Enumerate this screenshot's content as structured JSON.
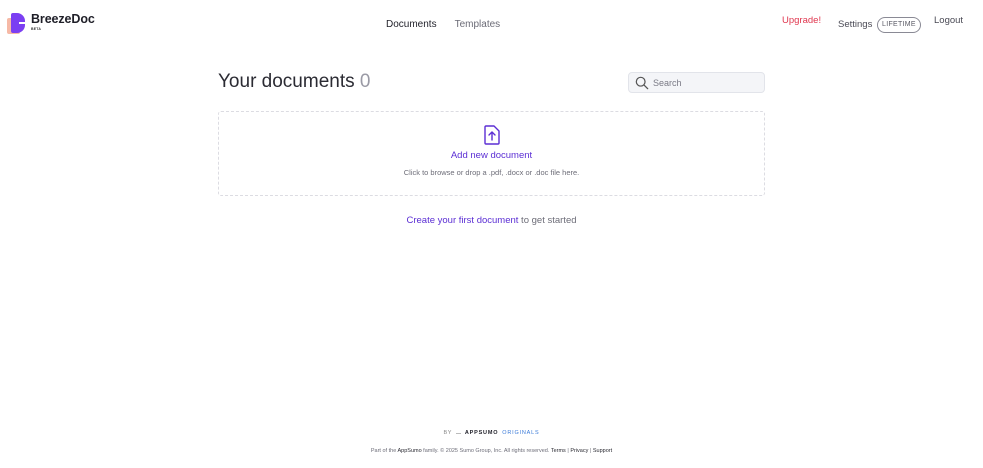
{
  "header": {
    "logo_name": "BreezeDoc",
    "logo_badge": "BETA",
    "nav": [
      {
        "label": "Documents",
        "active": true
      },
      {
        "label": "Templates",
        "active": false
      }
    ],
    "upgrade_label": "Upgrade!",
    "settings_label": "Settings",
    "plan_badge": "LIFETIME",
    "logout_label": "Logout"
  },
  "main": {
    "title": "Your documents",
    "count": "0",
    "search": {
      "placeholder": "Search",
      "value": ""
    },
    "dropzone": {
      "icon": "upload-file-icon",
      "title": "Add new document",
      "hint": "Click to browse or drop a .pdf, .docx or .doc file here."
    },
    "empty_state": {
      "link_text": "Create your first document",
      "suffix": " to get started"
    }
  },
  "footer": {
    "by": "BY",
    "brand": "APPSUMO",
    "brand_suffix": "ORIGINALS",
    "legal_prefix": "Part of the ",
    "legal_brand": "AppSumo",
    "legal_middle": " family. © 2025 Sumo Group, Inc. All rights reserved. ",
    "terms": "Terms",
    "sep1": " | ",
    "privacy": "Privacy",
    "sep2": " | ",
    "support": "Support"
  },
  "colors": {
    "accent": "#5b2ed4",
    "upgrade": "#e0374f",
    "logo_purple": "#7b3ff2",
    "logo_peach": "#f6b9a6"
  }
}
